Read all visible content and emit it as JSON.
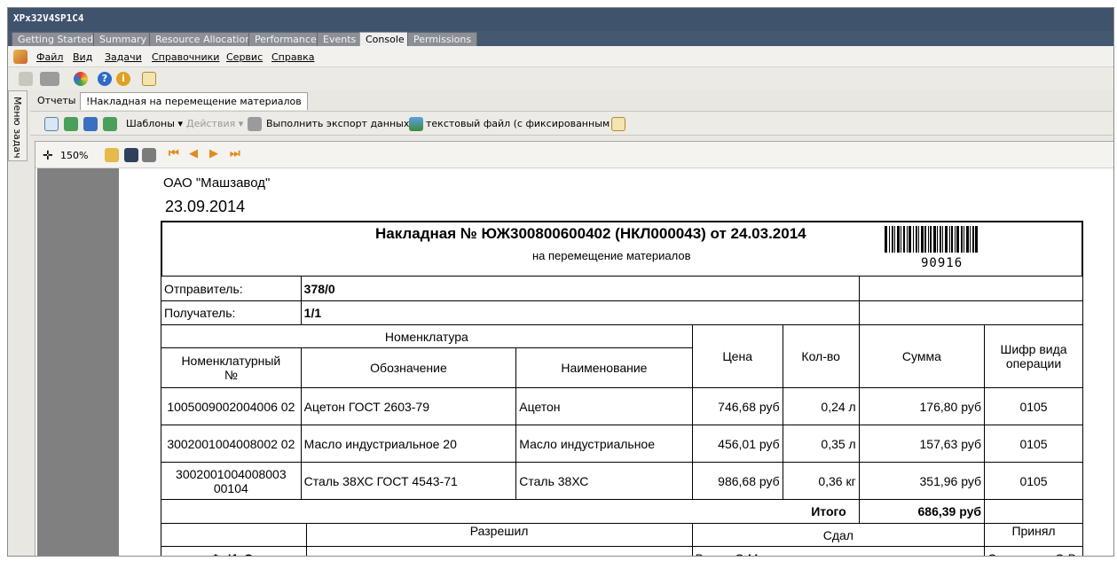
{
  "window": {
    "title": "XPx32V4SP1C4"
  },
  "tabs": [
    {
      "label": "Getting Started"
    },
    {
      "label": "Summary"
    },
    {
      "label": "Resource Allocation"
    },
    {
      "label": "Performance"
    },
    {
      "label": "Events"
    },
    {
      "label": "Console",
      "active": true
    },
    {
      "label": "Permissions"
    }
  ],
  "menu": {
    "items": [
      "Файл",
      "Вид",
      "Задачи",
      "Справочники",
      "Сервис",
      "Справка"
    ]
  },
  "sidebar": {
    "label": "Меню задач"
  },
  "subtabs": [
    {
      "label": "Отчеты"
    },
    {
      "label": "!Накладная на перемещение материалов",
      "active": true
    }
  ],
  "toolbar2": {
    "templates_label": "Шаблоны",
    "actions_label": "Действия",
    "export_label": "Выполнить экспорт данных в:",
    "export_value": "текстовый файл (с фиксированным"
  },
  "viewer": {
    "zoom": "150%"
  },
  "document": {
    "org": "ОАО \"Машзавод\"",
    "date": "23.09.2014",
    "title": "Накладная № ЮЖ300800600402 (НКЛ000043) от 24.03.2014",
    "subtitle": "на перемещение материалов",
    "barcode_number": "90916",
    "sender_label": "Отправитель:",
    "sender_value": "378/0",
    "receiver_label": "Получатель:",
    "receiver_value": "1/1",
    "headers": {
      "nomenclature": "Номенклатура",
      "nom_number": "Номенклатурный №",
      "designation": "Обозначение",
      "name": "Наименование",
      "price": "Цена",
      "qty": "Кол-во",
      "sum": "Сумма",
      "op_code": "Шифр вида операции"
    },
    "rows": [
      {
        "num": "1005009002004006 02",
        "designation": "Ацетон ГОСТ 2603-79",
        "name": "Ацетон",
        "price": "746,68 руб",
        "qty": "0,24 л",
        "sum": "176,80 руб",
        "op": "0105"
      },
      {
        "num": "3002001004008002 02",
        "designation": "Масло индустриальное 20",
        "name": "Масло индустриальное",
        "price": "456,01 руб",
        "qty": "0,35 л",
        "sum": "157,63 руб",
        "op": "0105"
      },
      {
        "num": "3002001004008003 00104",
        "designation": "Сталь 38ХС ГОСТ 4543-71",
        "name": "Сталь 38ХС",
        "price": "986,68 руб",
        "qty": "0,36 кг",
        "sum": "351,96 руб",
        "op": "0105"
      }
    ],
    "total_label": "Итого",
    "total_value": "686,39 руб",
    "sign": {
      "allowed": "Разрешил",
      "handed": "Сдал",
      "accepted": "Принял",
      "fio_label": "Ф. И. О.",
      "handed_name": "Ворон О.М.",
      "accepted_name": "Свиридова О.В."
    }
  }
}
